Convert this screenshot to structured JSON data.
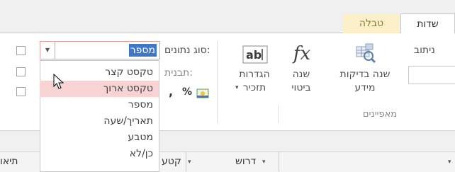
{
  "tabs": {
    "fields_label": "שדות",
    "table_label": "טבלה"
  },
  "ribbon": {
    "partial_left_label": "ניתוב",
    "test_data_label_line1": "שנה בדיקות",
    "test_data_label_line2": "מידע",
    "change_expression_line1": "שנה",
    "change_expression_line2": "ביטוי",
    "memo_settings_line1": "הגדרות",
    "memo_settings_line2": "תזכיר",
    "properties_group_label": "מאפיינים",
    "format_label": "תבנית:",
    "datatype_label": "סוג נתונים:",
    "datatype_value": "מספר",
    "percent_symbol": "%",
    "comma_symbol": ","
  },
  "dropdown_options": [
    "טקסט קצר",
    "טקסט ארוך",
    "מספר",
    "תאריך/שעה",
    "מטבע",
    "כן/לא"
  ],
  "highlighted_option": "טקסט ארוך",
  "column_headers": {
    "required": "דרוש",
    "text": "קטע",
    "description": "תיאו"
  },
  "colors": {
    "accent_tab": "#fbf0c9",
    "selection": "#3e77c4",
    "hover_highlight": "#f7d3d3"
  },
  "icons": [
    "fx-icon",
    "ab-textbox-icon",
    "test-validation-icon",
    "currency-format-icon",
    "dropdown-arrow-icon",
    "mouse-cursor-icon"
  ]
}
